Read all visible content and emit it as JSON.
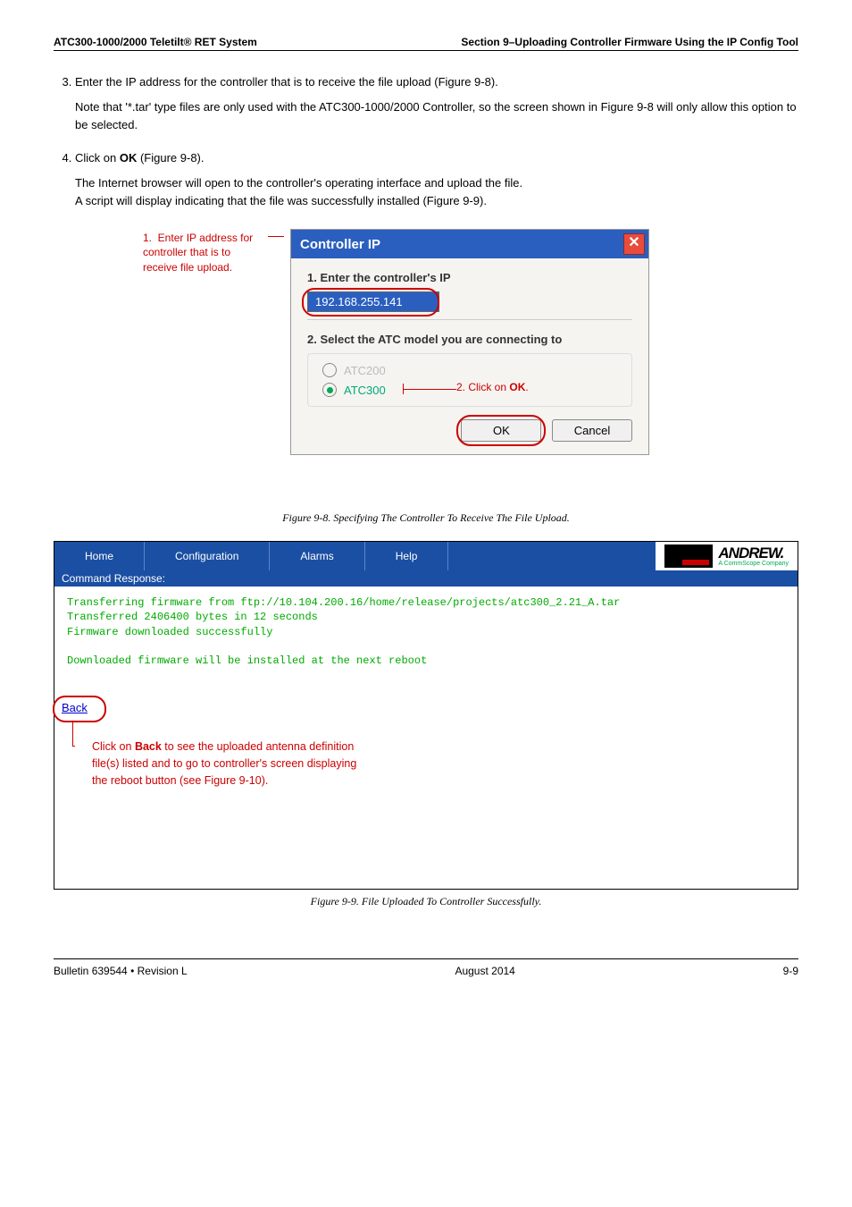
{
  "header": {
    "left": "ATC300-1000/2000 Teletilt® RET System",
    "right": "Section 9–Uploading Controller Firmware Using the IP Config Tool"
  },
  "list": {
    "item3": "Enter the IP address for the controller that is to receive the file upload (Figure 9-8).",
    "item3_note": "Note that '*.tar' type files are only used with the ATC300-1000/2000 Controller, so the screen shown in Figure 9-8 will only allow this option to be selected.",
    "item4_pre": "Click on ",
    "item4_bold": "OK",
    "item4_post": " (Figure 9-8).",
    "item4_note1": "The Internet browser will open to the controller's operating interface and upload the file.",
    "item4_note2": "A script will display indicating that the file was successfully installed (Figure 9-9)."
  },
  "fig8": {
    "annot1": "1.  Enter IP address for controller that is to receive file upload.",
    "title": "Controller IP",
    "label1": "1. Enter the controller's IP",
    "ip": "192.168.255.141",
    "label2": "2. Select the ATC model you are connecting to",
    "radio1": "ATC200",
    "radio2": "ATC300",
    "annot2_pre": "2.  Click on ",
    "annot2_bold": "OK",
    "annot2_post": ".",
    "ok": "OK",
    "cancel": "Cancel",
    "caption": "Figure 9-8.  Specifying The Controller To Receive The File Upload."
  },
  "fig9": {
    "tabs": [
      "Home",
      "Configuration",
      "Alarms",
      "Help"
    ],
    "logo_main": "ANDREW.",
    "logo_sub": "A CommScope Company",
    "cmdresp": "Command Response:",
    "term": "Transferring firmware from ftp://10.104.200.16/home/release/projects/atc300_2.21_A.tar\nTransferred 2406400 bytes in 12 seconds\nFirmware downloaded successfully\n\nDownloaded firmware will be installed at the next reboot",
    "back": "Back",
    "annot_pre": "Click on ",
    "annot_bold": "Back",
    "annot_mid": " to see the uploaded antenna definition\nfile(s) listed and to go to controller's screen displaying\nthe reboot button (see Figure 9-10).",
    "caption": "Figure 9-9.  File Uploaded To Controller Successfully."
  },
  "footer": {
    "left": "Bulletin 639544  •  Revision L",
    "center": "August 2014",
    "right": "9-9"
  }
}
